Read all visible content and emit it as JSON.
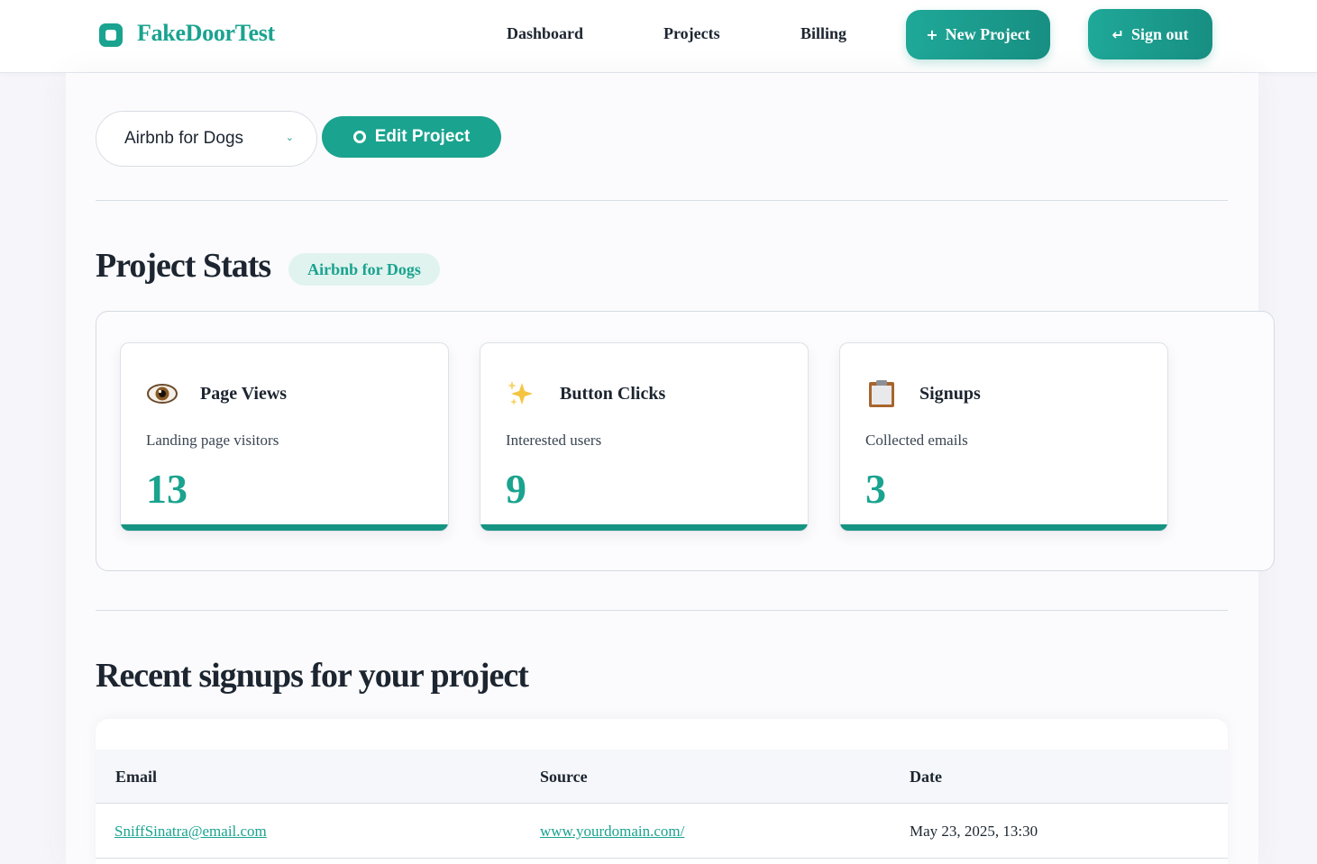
{
  "header": {
    "brand": "FakeDoorTest",
    "nav": [
      "Dashboard",
      "Projects",
      "Billing"
    ],
    "new_project_label": "New Project",
    "sign_out_label": "Sign out"
  },
  "project_bar": {
    "selected_project": "Airbnb for Dogs",
    "edit_label": "Edit Project"
  },
  "stats": {
    "title": "Project Stats",
    "badge": "Airbnb for Dogs",
    "cards": [
      {
        "icon": "eye-icon",
        "title": "Page Views",
        "subtitle": "Landing page visitors",
        "value": "13"
      },
      {
        "icon": "sparkles-icon",
        "title": "Button Clicks",
        "subtitle": "Interested users",
        "value": "9"
      },
      {
        "icon": "clipboard-icon",
        "title": "Signups",
        "subtitle": "Collected emails",
        "value": "3"
      }
    ]
  },
  "signups": {
    "title": "Recent signups for your project",
    "columns": [
      "Email",
      "Source",
      "Date"
    ],
    "rows": [
      {
        "email": "SniffSinatra@email.com",
        "source": "www.yourdomain.com/",
        "date": "May 23, 2025, 13:30"
      }
    ]
  },
  "colors": {
    "accent": "#1aa38f",
    "accent_dark": "#169482",
    "text": "#1c2530"
  }
}
